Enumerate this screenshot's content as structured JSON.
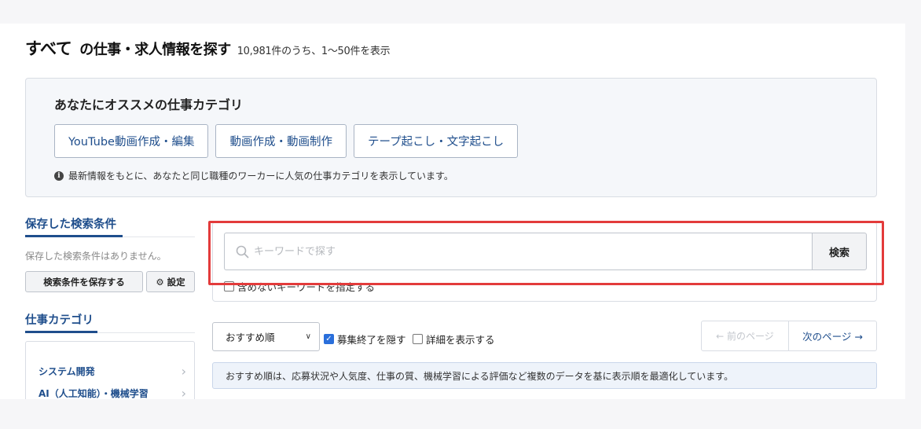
{
  "header": {
    "title_main": "すべて",
    "title_rest": "の仕事・求人情報を探す",
    "count_text": "10,981件のうち、1〜50件を表示"
  },
  "recommend": {
    "title": "あなたにオススメの仕事カテゴリ",
    "buttons": [
      "YouTube動画作成・編集",
      "動画作成・動画制作",
      "テープ起こし・文字起こし"
    ],
    "note": "最新情報をもとに、あなたと同じ職種のワーカーに人気の仕事カテゴリを表示しています。"
  },
  "sidebar": {
    "saved_heading": "保存した検索条件",
    "saved_empty": "保存した検索条件はありません。",
    "save_button": "検索条件を保存する",
    "settings_button": "設定",
    "category_heading": "仕事カテゴリ",
    "categories": [
      "システム開発",
      "AI（人工知能）・機械学習"
    ]
  },
  "search": {
    "placeholder": "キーワードで探す",
    "button": "検索",
    "exclude_label": "含めないキーワードを指定する"
  },
  "sort": {
    "selected": "おすすめ順",
    "hide_closed_label": "募集終了を隠す",
    "hide_closed_checked": true,
    "show_details_label": "詳細を表示する",
    "show_details_checked": false,
    "prev_page": "← 前のページ",
    "next_page": "次のページ →",
    "note": "おすすめ順は、応募状況や人気度、仕事の質、機械学習による評価など複数のデータを基に表示順を最適化しています。"
  },
  "colors": {
    "accent": "#1f4e8c",
    "highlight": "#e33b3b",
    "checkbox": "#2a6fdb"
  }
}
